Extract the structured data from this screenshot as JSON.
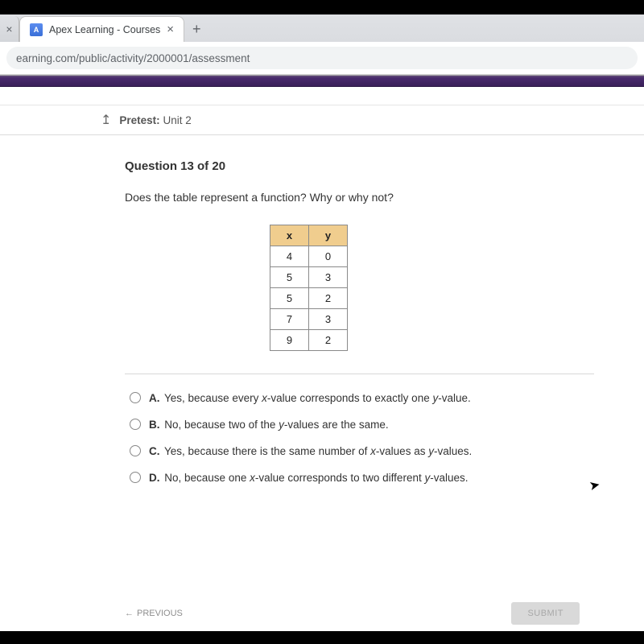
{
  "browser": {
    "tab_title": "Apex Learning - Courses",
    "url": "earning.com/public/activity/2000001/assessment"
  },
  "toolbar": {
    "pretest_label": "Pretest:",
    "unit_label": "Unit 2"
  },
  "question": {
    "header": "Question 13 of 20",
    "text": "Does the table represent a function? Why or why not?"
  },
  "table": {
    "h1": "x",
    "h2": "y",
    "rows": [
      {
        "x": "4",
        "y": "0"
      },
      {
        "x": "5",
        "y": "3"
      },
      {
        "x": "5",
        "y": "2"
      },
      {
        "x": "7",
        "y": "3"
      },
      {
        "x": "9",
        "y": "2"
      }
    ]
  },
  "options": {
    "a": {
      "label": "A.",
      "pre": "Yes, because every ",
      "v1": "x",
      "mid1": "-value corresponds to exactly one ",
      "v2": "y",
      "post": "-value."
    },
    "b": {
      "label": "B.",
      "pre": "No, because two of the ",
      "v1": "y",
      "post": "-values are the same."
    },
    "c": {
      "label": "C.",
      "pre": "Yes, because there is the same number of ",
      "v1": "x",
      "mid1": "-values as ",
      "v2": "y",
      "post": "-values."
    },
    "d": {
      "label": "D.",
      "pre": "No, because one ",
      "v1": "x",
      "mid1": "-value corresponds to two different ",
      "v2": "y",
      "post": "-values."
    }
  },
  "nav": {
    "previous": "PREVIOUS",
    "submit": "SUBMIT"
  }
}
